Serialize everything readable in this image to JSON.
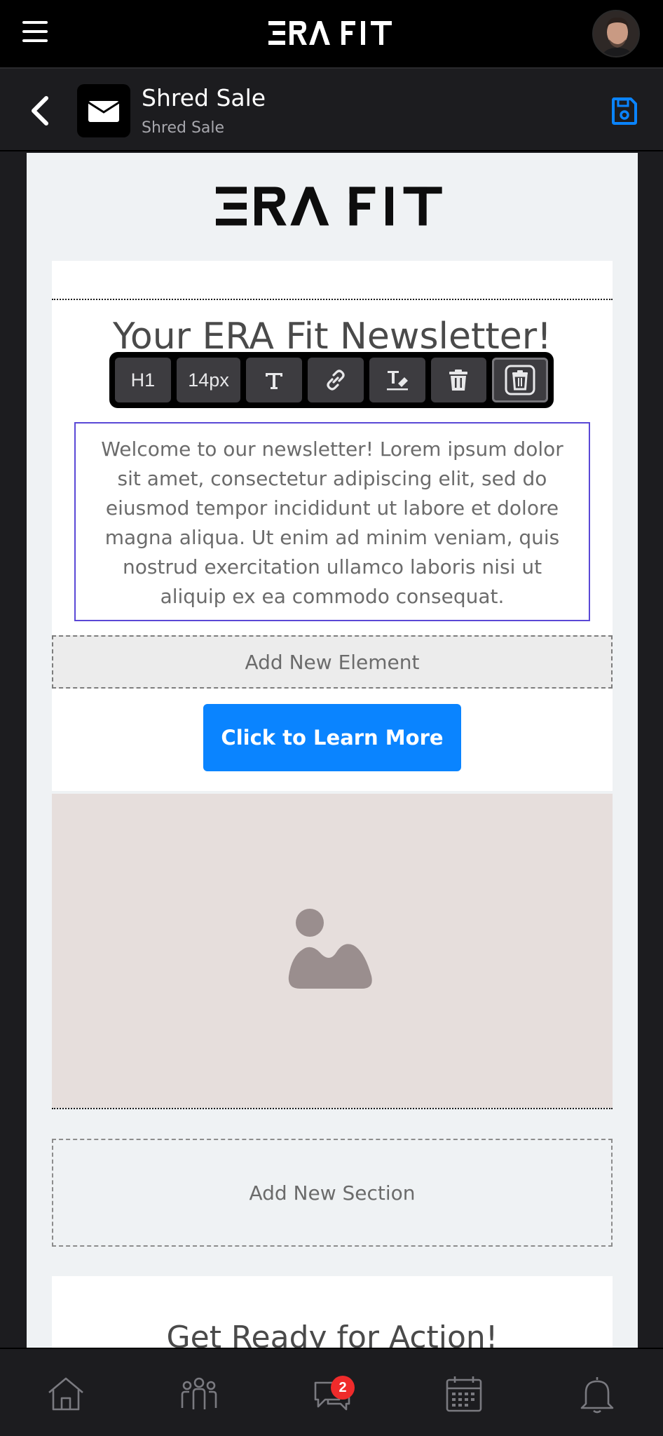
{
  "header": {
    "brand": "ERA FIT",
    "menu_icon": "hamburger-icon",
    "avatar_icon": "user-avatar"
  },
  "subheader": {
    "title": "Shred Sale",
    "subtitle": "Shred Sale",
    "back_icon": "chevron-left-icon",
    "tile_icon": "envelope-icon",
    "save_icon": "floppy-disk-icon",
    "accent": "#0a84ff"
  },
  "editor": {
    "logo_text": "ERA FIT",
    "headline": "Your ERA Fit Newsletter!",
    "toolbar": {
      "heading": "H1",
      "font_size": "14px",
      "text_icon": "text-format-icon",
      "link_icon": "link-icon",
      "clear_icon": "clear-format-icon",
      "delete_icon": "trash-icon",
      "delete_block_icon": "trash-outline-icon"
    },
    "body_text": "Welcome to our newsletter! Lorem ipsum dolor sit amet, consectetur adipiscing elit, sed do eiusmod tempor incididunt ut labore et dolore magna aliqua. Ut enim ad minim veniam, quis nostrud exercitation ullamco laboris nisi ut aliquip ex ea commodo consequat.",
    "add_element": "Add New Element",
    "cta_label": "Click to Learn More",
    "image_placeholder_icon": "image-placeholder-icon",
    "add_section": "Add New Section",
    "next_headline": "Get Ready for Action!"
  },
  "bottom_nav": {
    "items": [
      "home-icon",
      "people-icon",
      "chat-icon",
      "calendar-icon",
      "bell-icon"
    ],
    "chat_badge": "2"
  }
}
